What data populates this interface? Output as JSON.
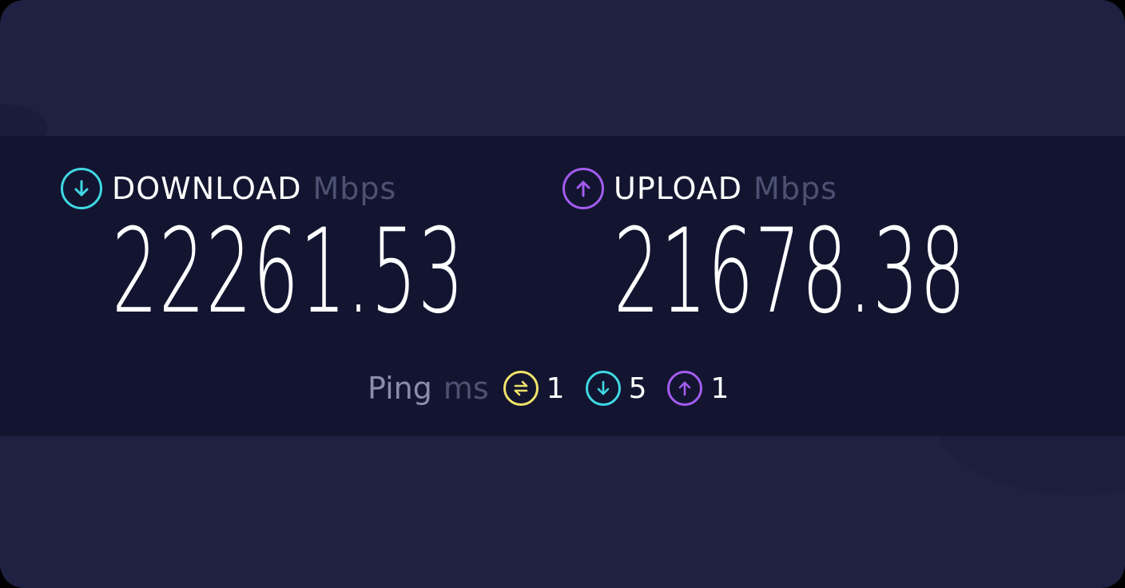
{
  "download": {
    "label": "DOWNLOAD",
    "unit": "Mbps",
    "value": "22261.53",
    "icon": "download-arrow-icon",
    "color": "#3fd8e4"
  },
  "upload": {
    "label": "UPLOAD",
    "unit": "Mbps",
    "value": "21678.38",
    "icon": "upload-arrow-icon",
    "color": "#a45cf0"
  },
  "ping": {
    "label": "Ping",
    "unit": "ms",
    "items": [
      {
        "icon": "jitter-icon",
        "color": "#f1e36a",
        "value": "1"
      },
      {
        "icon": "download-arrow-icon",
        "color": "#3fd8e4",
        "value": "5"
      },
      {
        "icon": "upload-arrow-icon",
        "color": "#a45cf0",
        "value": "1"
      }
    ]
  },
  "colors": {
    "background": "#1f2142",
    "band": "#131530",
    "muted_text": "#4d5172"
  }
}
